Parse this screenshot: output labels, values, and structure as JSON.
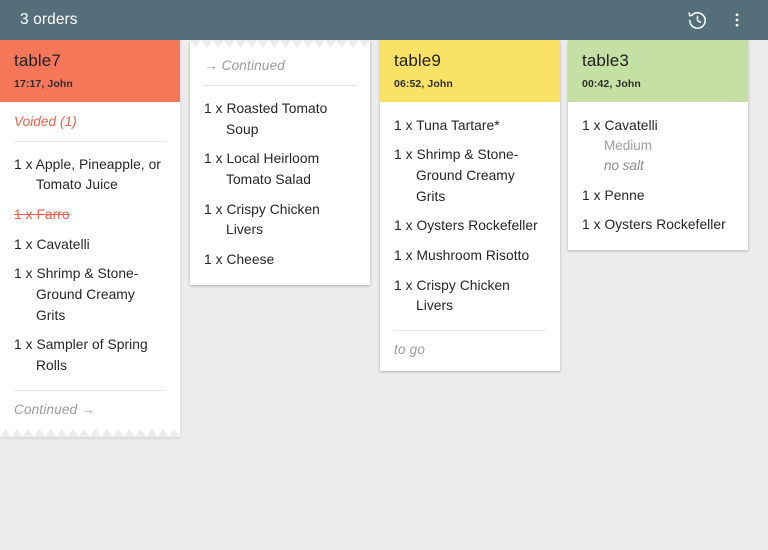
{
  "appbar": {
    "title": "3 orders",
    "history_icon": "history-clock-icon",
    "overflow_icon": "more-vert-icon",
    "bg_color": "#546e7a"
  },
  "colors": {
    "background": "#ececec",
    "card": "#ffffff",
    "voided_red": "#e8604c",
    "muted": "#9a9a9a",
    "header_orange": "#f4775a",
    "header_yellow": "#fae266",
    "header_green": "#c5e0a5"
  },
  "cards": [
    {
      "id": "card-table7",
      "table": "table7",
      "meta": "17:17, John",
      "header_color": "#f4775a",
      "has_header": true,
      "torn_top": false,
      "torn_bottom": true,
      "voided_label": "Voided (1)",
      "items": [
        {
          "text": "1 x Apple, Pineapple, or Tomato Juice",
          "voided": false,
          "mods": []
        },
        {
          "text": "1 x Farro",
          "voided": true,
          "mods": []
        },
        {
          "text": "1 x Cavatelli",
          "voided": false,
          "mods": []
        },
        {
          "text": "1 x Shrimp & Stone-Ground Creamy Grits",
          "voided": false,
          "mods": []
        },
        {
          "text": "1 x Sampler of Spring Rolls",
          "voided": false,
          "mods": []
        }
      ],
      "footnote": "Continued →"
    },
    {
      "id": "card-continued",
      "table": "",
      "meta": "",
      "header_color": "",
      "has_header": false,
      "torn_top": true,
      "torn_bottom": false,
      "continued_label": "→ Continued",
      "items": [
        {
          "text": "1 x Roasted Tomato Soup",
          "voided": false,
          "mods": []
        },
        {
          "text": "1 x Local Heirloom Tomato Salad",
          "voided": false,
          "mods": []
        },
        {
          "text": "1 x Crispy Chicken Livers",
          "voided": false,
          "mods": []
        },
        {
          "text": "1 x Cheese",
          "voided": false,
          "mods": []
        }
      ],
      "footnote": ""
    },
    {
      "id": "card-table9",
      "table": "table9",
      "meta": "06:52, John",
      "header_color": "#fae266",
      "has_header": true,
      "torn_top": false,
      "torn_bottom": false,
      "items": [
        {
          "text": "1 x Tuna Tartare*",
          "voided": false,
          "mods": []
        },
        {
          "text": "1 x Shrimp & Stone-Ground Creamy Grits",
          "voided": false,
          "mods": []
        },
        {
          "text": "1 x Oysters Rockefeller",
          "voided": false,
          "mods": []
        },
        {
          "text": "1 x Mushroom Risotto",
          "voided": false,
          "mods": []
        },
        {
          "text": "1 x Crispy Chicken Livers",
          "voided": false,
          "mods": []
        }
      ],
      "footnote": "to go"
    },
    {
      "id": "card-table3",
      "table": "table3",
      "meta": "00:42, John",
      "header_color": "#c5e0a5",
      "has_header": true,
      "torn_top": false,
      "torn_bottom": false,
      "items": [
        {
          "text": "1 x Cavatelli",
          "voided": false,
          "mods": [
            {
              "text": "Medium",
              "note": false
            },
            {
              "text": "no salt",
              "note": true
            }
          ]
        },
        {
          "text": "1 x Penne",
          "voided": false,
          "mods": []
        },
        {
          "text": "1 x Oysters Rockefeller",
          "voided": false,
          "mods": []
        }
      ],
      "footnote": ""
    }
  ]
}
